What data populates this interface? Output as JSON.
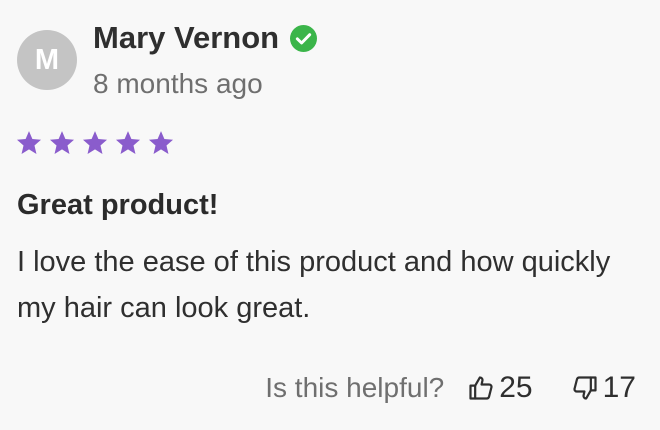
{
  "review": {
    "avatar_initial": "M",
    "author_name": "Mary Vernon",
    "verified": true,
    "timestamp": "8 months ago",
    "rating": 5,
    "rating_max": 5,
    "title": "Great product!",
    "body": "I love the ease of this product and how quickly my hair can look great."
  },
  "helpful": {
    "prompt": "Is this helpful?",
    "upvotes": "25",
    "downvotes": "17",
    "upvote_icon": "thumbs-up-icon",
    "downvote_icon": "thumbs-down-icon"
  },
  "colors": {
    "star": "#8a5ccc",
    "verified": "#3bb54a",
    "avatar_bg": "#c4c4c4"
  }
}
